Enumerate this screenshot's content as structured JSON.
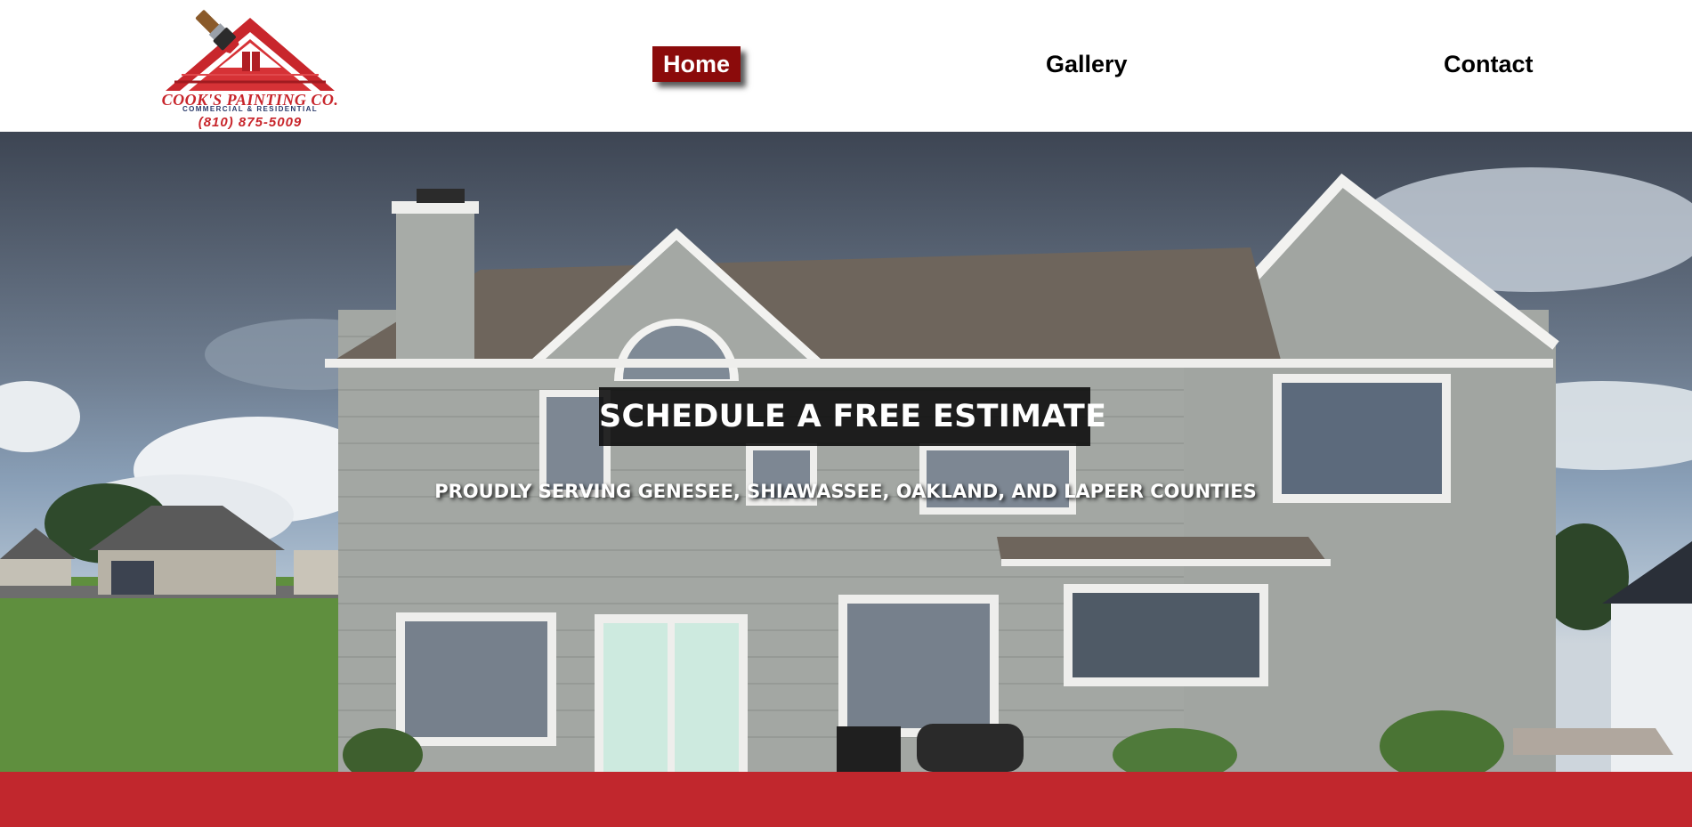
{
  "brand": {
    "name": "COOK'S PAINTING CO.",
    "tagline": "COMMERCIAL & RESIDENTIAL",
    "phone": "(810) 875-5009"
  },
  "nav": {
    "items": [
      {
        "label": "Home",
        "active": true
      },
      {
        "label": "Gallery",
        "active": false
      },
      {
        "label": "Contact",
        "active": false
      }
    ]
  },
  "hero": {
    "title": "SCHEDULE A FREE ESTIMATE",
    "subtitle": "PROUDLY SERVING GENESEE, SHIAWASSEE, OAKLAND, AND LAPEER COUNTIES"
  },
  "colors": {
    "brand_red": "#c1272d",
    "active_nav_bg": "#8b0b0b",
    "nav_text": "#000000"
  }
}
